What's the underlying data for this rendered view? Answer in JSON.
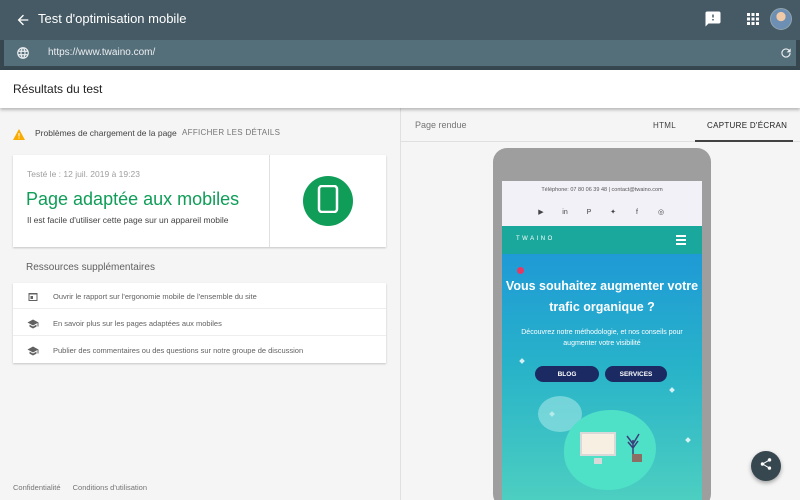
{
  "header": {
    "title": "Test d'optimisation mobile"
  },
  "urlbar": {
    "url": "https://www.twaino.com/"
  },
  "results": {
    "title": "Résultats du test"
  },
  "warning": {
    "text": "Problèmes de chargement de la page",
    "link": "AFFICHER LES DÉTAILS"
  },
  "result_card": {
    "tested": "Testé le : 12 juil. 2019 à 19:23",
    "headline": "Page adaptée aux mobiles",
    "subtitle": "Il est facile d'utiliser cette page sur un appareil mobile"
  },
  "resources": {
    "title": "Ressources supplémentaires",
    "items": [
      {
        "label": "Ouvrir le rapport sur l'ergonomie mobile de l'ensemble du site",
        "icon": "report-icon"
      },
      {
        "label": "En savoir plus sur les pages adaptées aux mobiles",
        "icon": "school-icon"
      },
      {
        "label": "Publier des commentaires ou des questions sur notre groupe de discussion",
        "icon": "school-icon"
      }
    ]
  },
  "footer": {
    "privacy": "Confidentialité",
    "terms": "Conditions d'utilisation"
  },
  "render_panel": {
    "label": "Page rendue",
    "tabs": [
      "HTML",
      "CAPTURE D'ÉCRAN"
    ],
    "active_tab": "CAPTURE D'ÉCRAN"
  },
  "rendered_site": {
    "contact": "Téléphone: 07 80 06 39 48  |  contact@twaino.com",
    "socials": [
      "youtube-icon",
      "linkedin-icon",
      "pinterest-icon",
      "twitter-icon",
      "facebook-icon",
      "instagram-icon"
    ],
    "brand": "TWAINO",
    "headline": "Vous souhaitez augmenter votre trafic organique ?",
    "paragraph": "Découvrez notre méthodologie, et nos conseils pour augmenter votre visibilité",
    "button_blog": "BLOG",
    "button_services": "SERVICES"
  },
  "colors": {
    "header_bg": "#455a64",
    "success_green": "#0f9d58",
    "site_teal": "#1aa89c",
    "site_navy": "#1b2a63"
  }
}
